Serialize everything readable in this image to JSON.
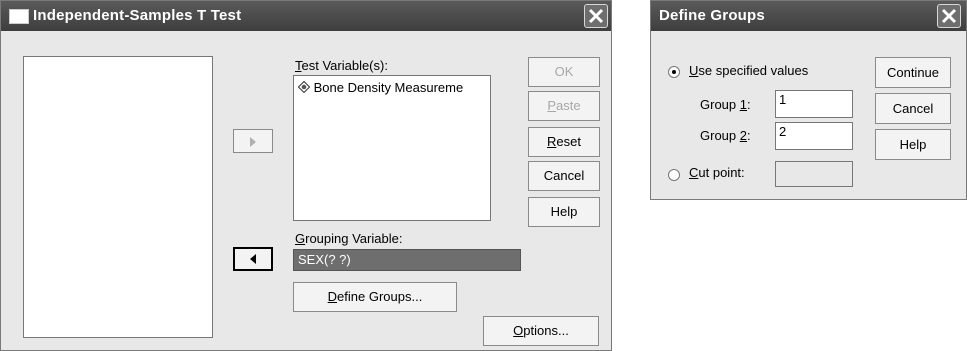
{
  "main_dialog": {
    "title": "Independent-Samples T Test",
    "test_vars": {
      "label_u": "T",
      "label_rest": "est Variable(s):",
      "items": [
        "Bone Density Measureme"
      ]
    },
    "grouping": {
      "label_u": "G",
      "label_rest": "rouping Variable:",
      "value": "SEX(? ?)"
    },
    "define_groups": {
      "label_u": "D",
      "label_rest": "efine Groups..."
    },
    "buttons": {
      "ok": "OK",
      "paste_u": "P",
      "paste_rest": "aste",
      "reset_u": "R",
      "reset_rest": "eset",
      "cancel": "Cancel",
      "help": "Help",
      "options_u": "O",
      "options_rest": "ptions..."
    },
    "icons": {
      "move_right": "arrow-right-icon",
      "move_left": "arrow-left-icon",
      "variable": "scale-variable-icon"
    }
  },
  "define_groups_dialog": {
    "title": "Define Groups",
    "use_specified": {
      "label_u": "U",
      "label_rest": "se specified values",
      "selected": true
    },
    "group1": {
      "label_pre": "Group ",
      "label_u": "1",
      "label_post": ":",
      "value": "1"
    },
    "group2": {
      "label_pre": "Group ",
      "label_u": "2",
      "label_post": ":",
      "value": "2"
    },
    "cut_point": {
      "label_u": "C",
      "label_rest": "ut point:",
      "selected": false,
      "value": ""
    },
    "buttons": {
      "continue": "Continue",
      "cancel": "Cancel",
      "help": "Help"
    }
  },
  "colors": {
    "titlebar": "#4a4a4a",
    "dialog_bg": "#e8e8e8",
    "grouping_bg": "#6e6e6e"
  }
}
